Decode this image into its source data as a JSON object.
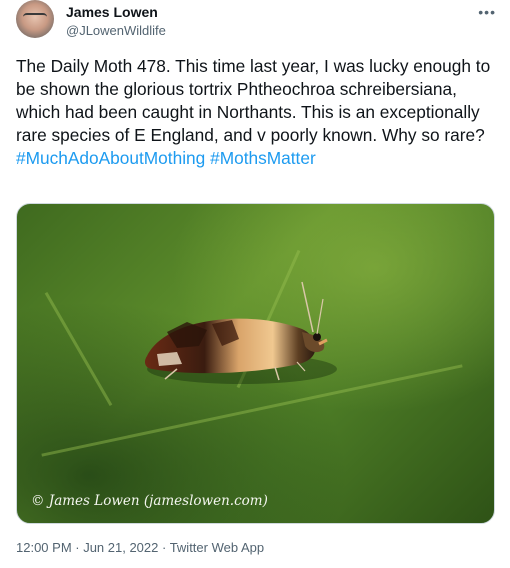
{
  "author": {
    "name": "James Lowen",
    "handle": "@JLowenWildlife"
  },
  "more_icon": "more-horizontal-icon",
  "tweet": {
    "text": "The Daily Moth 478. This time last year, I was lucky enough to be shown the glorious tortrix Phtheochroa schreibersiana, which had been caught in Northants. This is an exceptionally rare species of E England, and v poorly known. Why so rare?",
    "hashtags": [
      "#MuchAdoAboutMothing",
      "#MothsMatter"
    ]
  },
  "photo": {
    "credit": "© James Lowen (jameslowen.com)"
  },
  "meta": {
    "timestamp": "12:00 PM · Jun 21, 2022 · Twitter Web App"
  },
  "colors": {
    "text": "#0f1419",
    "secondary": "#536471",
    "link": "#1d9bf0"
  }
}
